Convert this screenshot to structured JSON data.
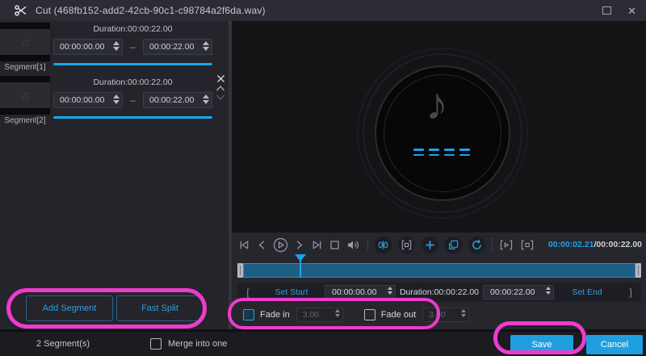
{
  "window": {
    "title": "Cut (468fb152-add2-42cb-90c1-c98784a2f6da.wav)"
  },
  "segments": {
    "dash": "–",
    "items": [
      {
        "label": "Segment[1]",
        "duration": "Duration:00:00:22.00",
        "start": "00:00:00.00",
        "end": "00:00:22.00"
      },
      {
        "label": "Segment[2]",
        "duration": "Duration:00:00:22.00",
        "start": "00:00:00.00",
        "end": "00:00:22.00"
      }
    ],
    "add_segment": "Add Segment",
    "fast_split": "Fast Split"
  },
  "transport": {
    "current": "00:00:02.21",
    "total": "/00:00:22.00"
  },
  "trim": {
    "open_bracket": "[",
    "set_start": "Set Start",
    "start": "00:00:00.00",
    "duration": "Duration:00:00:22.00",
    "end": "00:00:22.00",
    "set_end": "Set End",
    "close_bracket": "]"
  },
  "fade": {
    "in_label": "Fade in",
    "in_value": "3.00",
    "out_label": "Fade out",
    "out_value": "3.00"
  },
  "footer": {
    "count": "2 Segment(s)",
    "merge": "Merge into one",
    "save": "Save",
    "cancel": "Cancel"
  },
  "colors": {
    "accent": "#1ba4ea",
    "annotation": "#ee3bcd",
    "button_blue": "#1f9fdf",
    "timeline_fill": "#1e5e82"
  }
}
